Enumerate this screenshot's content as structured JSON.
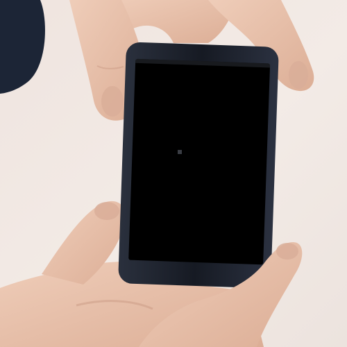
{
  "scene": {
    "background_color": "#f1e9e4",
    "skin_color": "#e8c0aa",
    "skin_shadow_color": "#c99a84",
    "sleeve_color": "#1c2536",
    "phone_body_color": "#1b1f2a",
    "phone_screen_color": "#000000",
    "screen_state": "off"
  }
}
